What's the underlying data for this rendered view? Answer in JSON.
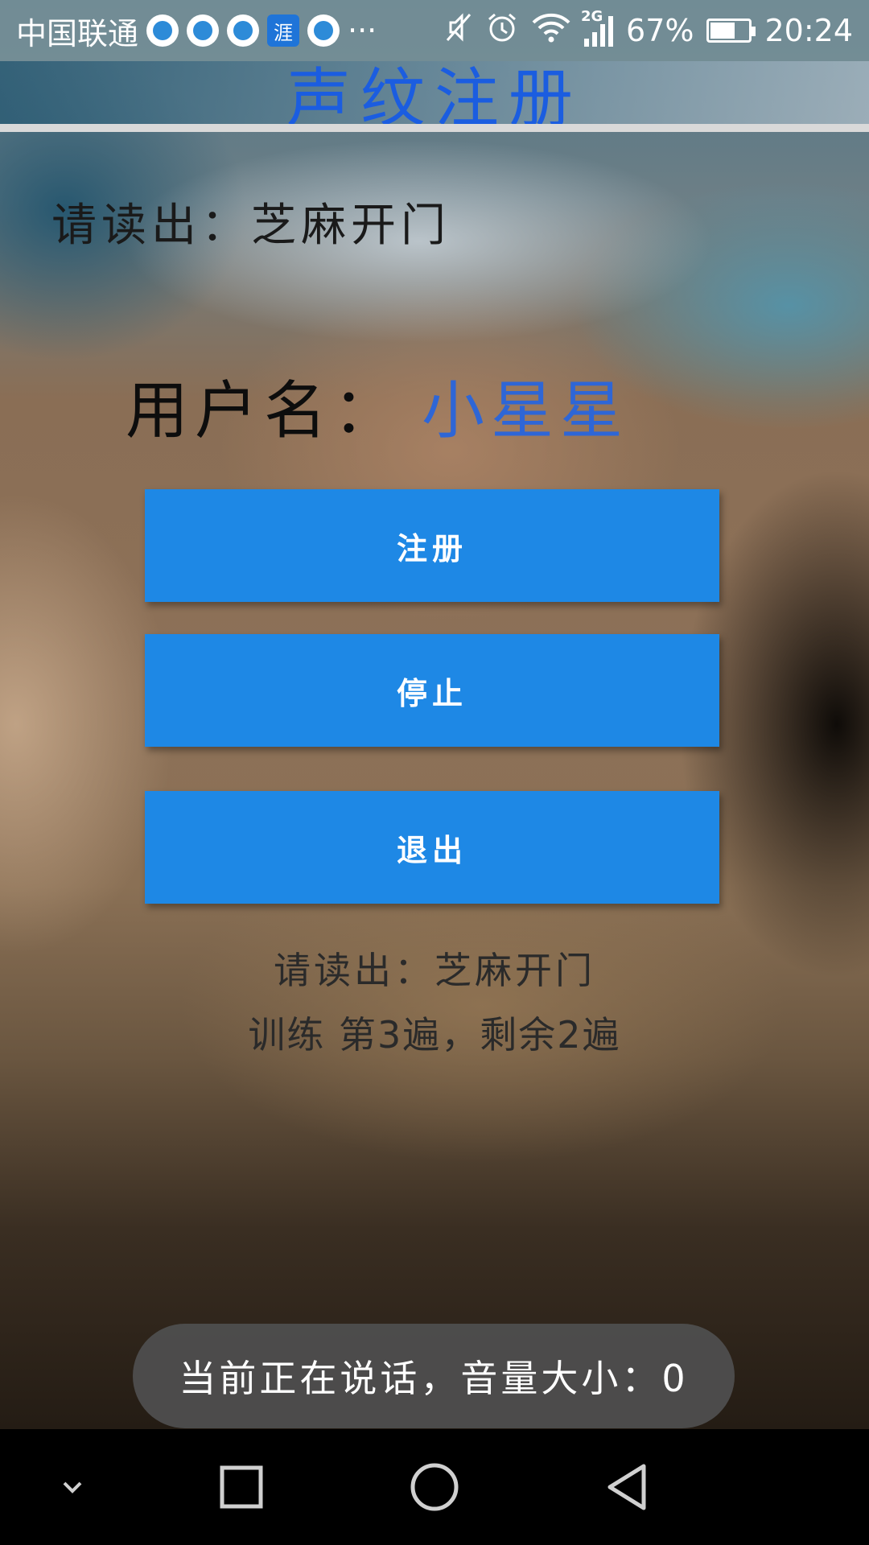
{
  "status_bar": {
    "carrier": "中国联通",
    "overflow": "···",
    "network_type": "2G",
    "battery_percent": "67%",
    "battery_level": 0.67,
    "time": "20:24",
    "notification_app_label": "涯",
    "icons": [
      "browser-notification-icon",
      "mute-icon",
      "alarm-icon",
      "wifi-icon",
      "signal-icon",
      "battery-charging-icon"
    ]
  },
  "header": {
    "title": "声纹注册"
  },
  "main": {
    "prompt": "请读出：芝麻开门",
    "username_label": "用户名：",
    "username_value": "小星星",
    "buttons": {
      "register": "注册",
      "stop": "停止",
      "exit": "退出"
    },
    "bottom_prompt": "请读出：芝麻开门",
    "training_progress": "训练 第3遍，剩余2遍"
  },
  "toast": {
    "text": "当前正在说话，音量大小：0"
  },
  "colors": {
    "accent": "#1e88e5",
    "title": "#1b5de0",
    "username_value": "#2e66d6"
  }
}
